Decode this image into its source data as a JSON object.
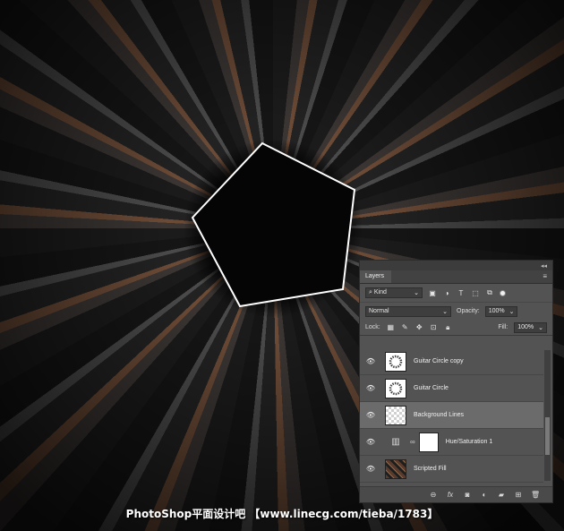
{
  "panel": {
    "tab": "Layers",
    "collapse_icon": "collapse-icon",
    "menu_icon": "panel-menu-icon",
    "filter": {
      "kind_label": "Kind",
      "icons": [
        "image-filter-icon",
        "adjustment-filter-icon",
        "type-filter-icon",
        "shape-filter-icon",
        "smart-object-filter-icon"
      ]
    },
    "blend_mode": "Normal",
    "opacity_label": "Opacity:",
    "opacity_value": "100%",
    "lock_label": "Lock:",
    "fill_label": "Fill:",
    "fill_value": "100%",
    "layers": [
      {
        "name": "Guitar Circle copy",
        "visible": true,
        "selected": false,
        "thumb": "white-pattern"
      },
      {
        "name": "Guitar Circle",
        "visible": true,
        "selected": false,
        "thumb": "white-pattern"
      },
      {
        "name": "Background Lines",
        "visible": true,
        "selected": true,
        "thumb": "transparent"
      },
      {
        "name": "Hue/Saturation 1",
        "visible": true,
        "selected": false,
        "thumb": "adjustment"
      },
      {
        "name": "Scripted Fill",
        "visible": true,
        "selected": false,
        "thumb": "photo"
      }
    ],
    "bottom_icons": [
      "link-layers-icon",
      "fx-icon",
      "add-mask-icon",
      "new-adjustment-icon",
      "new-group-icon",
      "new-layer-icon",
      "delete-layer-icon"
    ]
  },
  "watermark": "PhotoShop平面设计吧 【www.linecg.com/tieba/1783】",
  "colors": {
    "panel_bg": "#535353",
    "selected_row": "#6b6b6b",
    "pentagon_stroke": "#ffffff"
  }
}
